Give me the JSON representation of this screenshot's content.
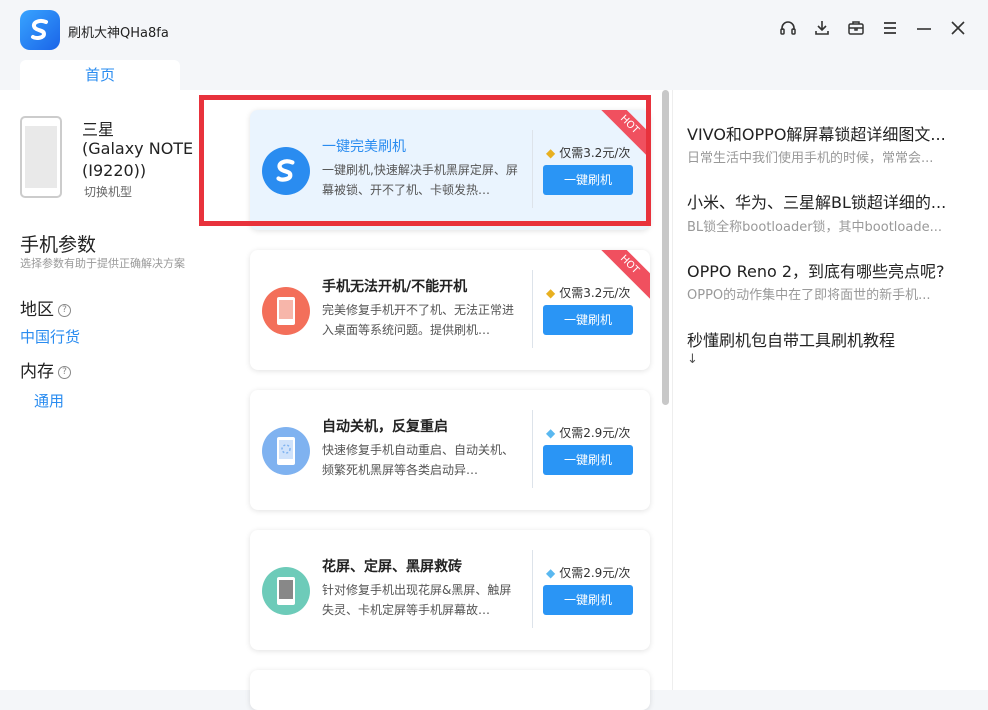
{
  "app": {
    "title": "刷机大神QHa8fa"
  },
  "tabs": [
    {
      "label": "首页"
    }
  ],
  "device": {
    "brand": "三星",
    "model": "(Galaxy NOTE (I9220))",
    "switch_label": "切换机型"
  },
  "params": {
    "title": "手机参数",
    "subtitle": "选择参数有助于提供正确解决方案",
    "region_label": "地区",
    "region_value": "中国行货",
    "memory_label": "内存",
    "memory_value": "通用",
    "help_glyph": "?"
  },
  "cards": [
    {
      "title": "一键完美刷机",
      "desc": "一键刷机,快速解决手机黑屏定屏、屏幕被锁、开不了机、卡顿发热…",
      "price": "仅需3.2元/次",
      "button": "一键刷机",
      "badge": "HOT",
      "icon": "s-logo-icon",
      "icon_color": "#2a8cf0",
      "price_icon": "gold-diamond-icon"
    },
    {
      "title": "手机无法开机/不能开机",
      "desc": "完美修复手机开不了机、无法正常进入桌面等系统问题。提供刷机…",
      "price": "仅需3.2元/次",
      "button": "一键刷机",
      "badge": "HOT",
      "icon": "phone-icon",
      "icon_color": "#f36f5a",
      "price_icon": "gold-diamond-icon"
    },
    {
      "title": "自动关机，反复重启",
      "desc": "快速修复手机自动重启、自动关机、频繁死机黑屏等各类启动异…",
      "price": "仅需2.9元/次",
      "button": "一键刷机",
      "badge": "",
      "icon": "phone-loading-icon",
      "icon_color": "#7fb2f0",
      "price_icon": "blue-diamond-icon"
    },
    {
      "title": "花屏、定屏、黑屏救砖",
      "desc": "针对修复手机出现花屏&黑屏、触屏失灵、卡机定屏等手机屏幕故…",
      "price": "仅需2.9元/次",
      "button": "一键刷机",
      "badge": "",
      "icon": "phone-screen-icon",
      "icon_color": "#6dcbb9",
      "price_icon": "blue-diamond-icon"
    }
  ],
  "articles": [
    {
      "title": "VIVO和OPPO解屏幕锁超详细图文...",
      "desc": "日常生活中我们使用手机的时候，常常会..."
    },
    {
      "title": "小米、华为、三星解BL锁超详细的...",
      "desc": "BL锁全称bootloader锁，其中bootloade..."
    },
    {
      "title": "OPPO Reno 2，到底有哪些亮点呢?",
      "desc": "OPPO的动作集中在了即将面世的新手机..."
    },
    {
      "title": "秒懂刷机包自带工具刷机教程",
      "desc": "↓"
    }
  ]
}
